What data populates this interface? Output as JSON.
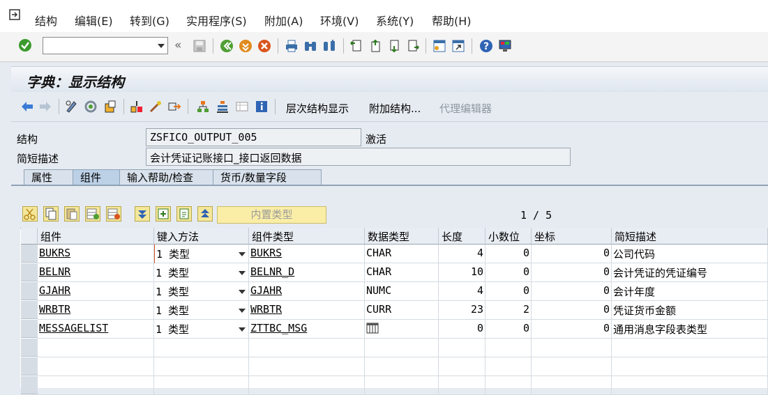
{
  "menu": [
    "结构",
    "编辑(E)",
    "转到(G)",
    "实用程序(S)",
    "附加(A)",
    "环境(V)",
    "系统(Y)",
    "帮助(H)"
  ],
  "toolbar": {
    "command_value": "",
    "nav_back_label": "«"
  },
  "title": "字典：显示结构",
  "app_toolbar": {
    "hierarchy_label": "层次结构显示",
    "append_label": "附加结构...",
    "proxy_label": "代理编辑器"
  },
  "fields": {
    "structure_label": "结构",
    "structure_value": "ZSFICO_OUTPUT_005",
    "status": "激活",
    "desc_label": "简短描述",
    "desc_value": "会计凭证记账接口_接口返回数据"
  },
  "tabs": [
    "属性",
    "组件",
    "输入帮助/检查",
    "货币/数量字段"
  ],
  "active_tab": "组件",
  "table_tools": {
    "builtin_type_label": "内置类型",
    "page_info": "1 / 5"
  },
  "table": {
    "columns": [
      "组件",
      "键入方法",
      "组件类型",
      "数据类型",
      "长度",
      "小数位",
      "坐标",
      "简短描述"
    ],
    "rows": [
      {
        "component": "BUKRS",
        "method": "1 类型",
        "comptype": "BUKRS",
        "datatype": "CHAR",
        "length": "4",
        "decimals": "0",
        "coord": "0",
        "desc": "公司代码"
      },
      {
        "component": "BELNR",
        "method": "1 类型",
        "comptype": "BELNR_D",
        "datatype": "CHAR",
        "length": "10",
        "decimals": "0",
        "coord": "0",
        "desc": "会计凭证的凭证编号"
      },
      {
        "component": "GJAHR",
        "method": "1 类型",
        "comptype": "GJAHR",
        "datatype": "NUMC",
        "length": "4",
        "decimals": "0",
        "coord": "0",
        "desc": "会计年度"
      },
      {
        "component": "WRBTR",
        "method": "1 类型",
        "comptype": "WRBTR",
        "datatype": "CURR",
        "length": "23",
        "decimals": "2",
        "coord": "0",
        "desc": "凭证货币金额"
      },
      {
        "component": "MESSAGELIST",
        "method": "1 类型",
        "comptype": "ZTTBC_MSG",
        "datatype": "",
        "length": "0",
        "decimals": "0",
        "coord": "0",
        "desc": "通用消息字段表类型"
      }
    ]
  }
}
